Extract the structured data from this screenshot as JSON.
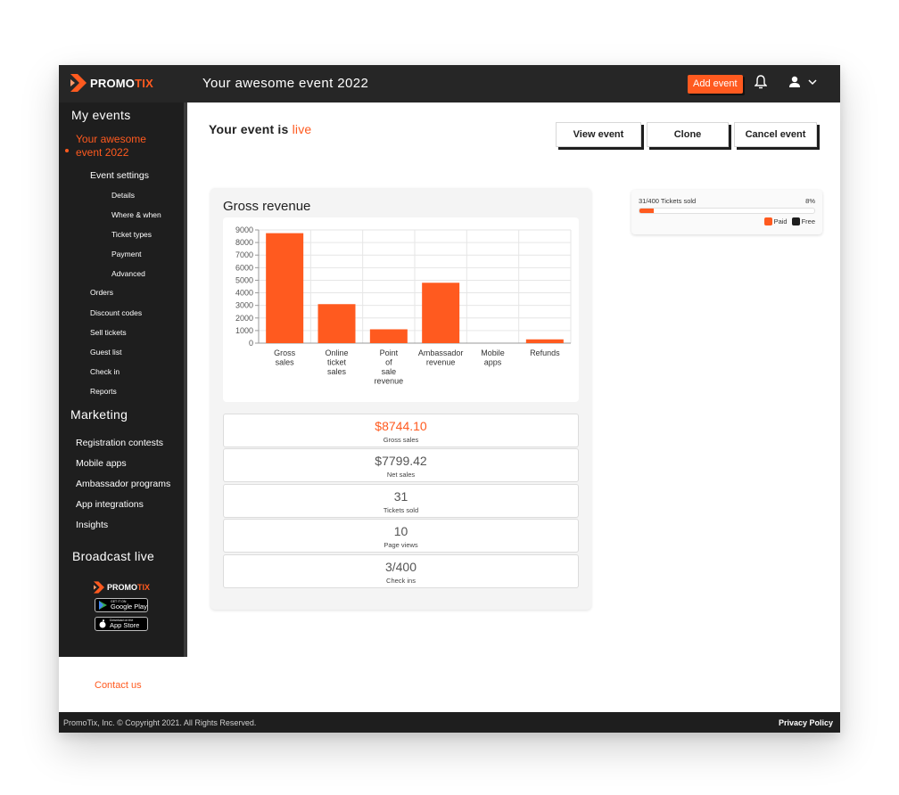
{
  "header": {
    "brand": {
      "part1": "PROMO",
      "part2": "TIX"
    },
    "event_title": "Your awesome event 2022",
    "add_event_label": "Add event"
  },
  "sidebar": {
    "my_events": "My events",
    "active_event": "Your awesome event 2022",
    "event_settings": "Event settings",
    "settings_items": [
      "Details",
      "Where & when",
      "Ticket types",
      "Payment",
      "Advanced"
    ],
    "event_items": [
      "Orders",
      "Discount codes",
      "Sell tickets",
      "Guest list",
      "Check in",
      "Reports"
    ],
    "marketing": "Marketing",
    "marketing_items": [
      "Registration contests",
      "Mobile apps",
      "Ambassador programs",
      "App integrations",
      "Insights"
    ],
    "broadcast": "Broadcast live",
    "google_play": {
      "small": "GET IT ON",
      "big": "Google Play"
    },
    "app_store": {
      "small": "Download on the",
      "big": "App Store"
    },
    "contact": "Contact us"
  },
  "main": {
    "status_prefix": "Your event is",
    "status_word": "live",
    "buttons": {
      "view": "View event",
      "clone": "Clone",
      "cancel": "Cancel event"
    },
    "revenue_title": "Gross revenue",
    "stats": [
      {
        "value": "$8744.10",
        "label": "Gross sales"
      },
      {
        "value": "$7799.42",
        "label": "Net sales"
      },
      {
        "value": "31",
        "label": "Tickets sold"
      },
      {
        "value": "10",
        "label": "Page views"
      },
      {
        "value": "3/400",
        "label": "Check ins"
      }
    ],
    "tickets": {
      "label": "31/400 Tickets sold",
      "percent_text": "8%",
      "fill_fraction": 0.08,
      "legend": [
        {
          "name": "Paid",
          "color": "#ff5a1f"
        },
        {
          "name": "Free",
          "color": "#1e1e1e"
        }
      ]
    }
  },
  "footer": {
    "copyright": "PromoTix, Inc. © Copyright 2021. All Rights Reserved.",
    "privacy": "Privacy Policy"
  },
  "colors": {
    "accent": "#ff5a1f",
    "dark": "#1e1e1e"
  },
  "chart_data": {
    "type": "bar",
    "categories": [
      [
        "Gross",
        "sales"
      ],
      [
        "Online",
        "ticket",
        "sales"
      ],
      [
        "Point",
        "of",
        "sale",
        "revenue"
      ],
      [
        "Ambassador",
        "revenue"
      ],
      [
        "Mobile",
        "apps"
      ],
      [
        "Refunds"
      ]
    ],
    "values": [
      8744.1,
      3100,
      1100,
      4800,
      0,
      300
    ],
    "ylim": [
      0,
      9000
    ],
    "yticks": [
      0,
      1000,
      2000,
      3000,
      4000,
      5000,
      6000,
      7000,
      8000,
      9000
    ],
    "grid": true,
    "color": "#ff5a1f"
  }
}
